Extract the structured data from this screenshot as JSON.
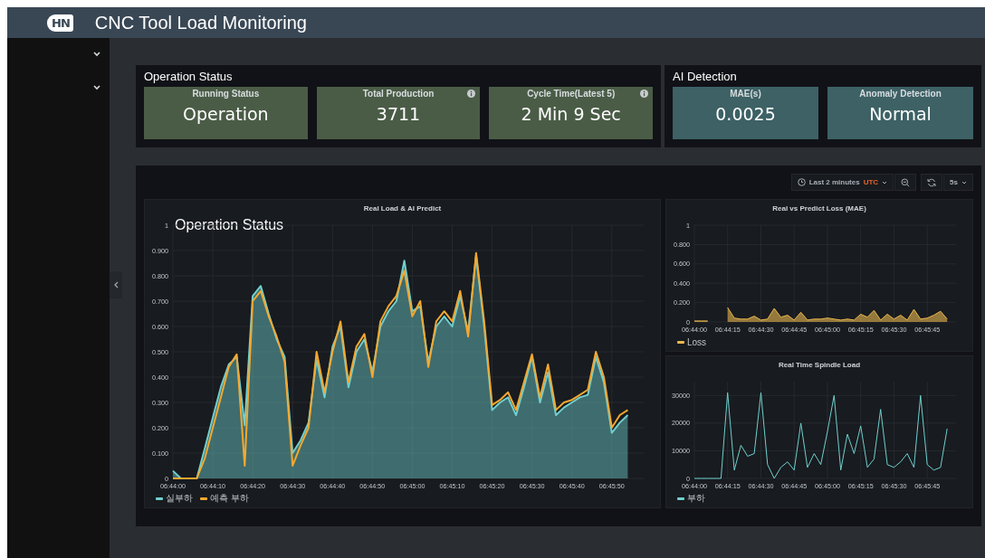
{
  "header": {
    "logo": "HN",
    "title": "CNC Tool Load Monitoring"
  },
  "status_panels": [
    {
      "title": "Operation Status",
      "cards": [
        {
          "label": "Running Status",
          "value": "Operation",
          "info": false,
          "color": "#4a5c46"
        },
        {
          "label": "Total Production",
          "value": "3711",
          "info": true,
          "color": "#4a5c46"
        },
        {
          "label": "Cycle Time(Latest 5)",
          "value": "2 Min 9 Sec",
          "info": true,
          "color": "#4a5c46"
        }
      ]
    },
    {
      "title": "AI Detection",
      "cards": [
        {
          "label": "MAE(s)",
          "value": "0.0025",
          "info": false,
          "color": "#3d6165"
        },
        {
          "label": "Anomaly Detection",
          "value": "Normal",
          "info": false,
          "color": "#3d6165"
        }
      ]
    }
  ],
  "toolbar": {
    "time_range": "Last 2 minutes",
    "timezone": "UTC",
    "refresh": "5s"
  },
  "charts": [
    {
      "overlay": "Operation Status",
      "chart_data": {
        "type": "area",
        "title": "Real Load & AI Predict",
        "grid": true,
        "categories": [
          "06:44:00",
          null,
          null,
          null,
          null,
          "06:44:10",
          null,
          null,
          null,
          null,
          "06:44:20",
          null,
          null,
          null,
          null,
          "06:44:30",
          null,
          null,
          null,
          null,
          "06:44:40",
          null,
          null,
          null,
          null,
          "06:44:50",
          null,
          null,
          null,
          null,
          "06:45:00",
          null,
          null,
          null,
          null,
          "06:45:10",
          null,
          null,
          null,
          null,
          "06:45:20",
          null,
          null,
          null,
          null,
          "06:45:30",
          null,
          null,
          null,
          null,
          "06:45:40",
          null,
          null,
          null,
          null,
          "06:45:50",
          null,
          null
        ],
        "series": [
          {
            "name": "실부하",
            "color": "#6fd0cf",
            "values": [
              0.03,
              0,
              0,
              0,
              0.12,
              0.24,
              0.36,
              0.45,
              0.48,
              0.21,
              0.72,
              0.76,
              0.65,
              0.55,
              0.48,
              0.1,
              0.15,
              0.22,
              0.47,
              0.32,
              0.52,
              0.6,
              0.36,
              0.5,
              0.55,
              0.42,
              0.6,
              0.66,
              0.7,
              0.86,
              0.66,
              0.68,
              0.46,
              0.6,
              0.64,
              0.6,
              0.72,
              0.58,
              0.88,
              0.6,
              0.27,
              0.3,
              0.32,
              0.25,
              0.36,
              0.48,
              0.3,
              0.42,
              0.25,
              0.28,
              0.3,
              0.32,
              0.33,
              0.48,
              0.38,
              0.18,
              0.22,
              0.25
            ]
          },
          {
            "name": "예측 부하",
            "type": "line",
            "color": "#f5a830",
            "values": [
              0,
              0,
              0,
              0,
              0.08,
              0.2,
              0.32,
              0.44,
              0.49,
              0.05,
              0.7,
              0.74,
              0.64,
              0.56,
              0.46,
              0.05,
              0.13,
              0.2,
              0.5,
              0.34,
              0.5,
              0.62,
              0.38,
              0.52,
              0.57,
              0.4,
              0.62,
              0.68,
              0.72,
              0.82,
              0.64,
              0.7,
              0.44,
              0.62,
              0.66,
              0.62,
              0.74,
              0.56,
              0.89,
              0.62,
              0.29,
              0.31,
              0.34,
              0.27,
              0.38,
              0.49,
              0.32,
              0.45,
              0.27,
              0.3,
              0.31,
              0.33,
              0.35,
              0.5,
              0.4,
              0.2,
              0.25,
              0.27
            ]
          }
        ],
        "ylim": [
          0,
          1
        ],
        "yticks": [
          0,
          {
            "value": 0.1,
            "label": "0.100"
          },
          {
            "value": 0.2,
            "label": "0.200"
          },
          {
            "value": 0.3,
            "label": "0.300"
          },
          {
            "value": 0.4,
            "label": "0.400"
          },
          {
            "value": 0.5,
            "label": "0.500"
          },
          {
            "value": 0.6,
            "label": "0.600"
          },
          {
            "value": 0.7,
            "label": "0.700"
          },
          {
            "value": 0.8,
            "label": "0.800"
          },
          {
            "value": 0.9,
            "label": "0.900"
          },
          1
        ]
      }
    },
    {
      "chart_data": {
        "type": "area",
        "title": "Real vs Predict Loss (MAE)",
        "grid": true,
        "categories": [
          "06:44:00",
          null,
          null,
          null,
          null,
          "06:44:15",
          null,
          null,
          null,
          null,
          "06:44:30",
          null,
          null,
          null,
          null,
          "06:44:45",
          null,
          null,
          null,
          null,
          "06:45:00",
          null,
          null,
          null,
          null,
          "06:45:15",
          null,
          null,
          null,
          null,
          "06:45:30",
          null,
          null,
          null,
          null,
          "06:45:45",
          null,
          null,
          null
        ],
        "series": [
          {
            "name": "Loss",
            "color": "#eab84f",
            "values": [
              0.01,
              0.01,
              0.01,
              null,
              null,
              0.15,
              0.04,
              0.03,
              0.03,
              0.06,
              0.02,
              0.03,
              0.14,
              0.05,
              0.07,
              0.02,
              0.1,
              0.02,
              0.03,
              0.03,
              0.04,
              0.03,
              0.02,
              0.03,
              0.02,
              0.08,
              0.05,
              0.12,
              0.02,
              0.08,
              0.03,
              0.07,
              0.02,
              0.13,
              0.03,
              0.04,
              0.07,
              0.11,
              0.03
            ]
          }
        ],
        "ylim": [
          0,
          1
        ],
        "yticks": [
          0,
          {
            "value": 0.2,
            "label": "0.200"
          },
          {
            "value": 0.4,
            "label": "0.400"
          },
          {
            "value": 0.6,
            "label": "0.600"
          },
          {
            "value": 0.8,
            "label": "0.800"
          },
          1
        ]
      }
    },
    {
      "chart_data": {
        "type": "line",
        "title": "Real Time Spindle Load",
        "grid": true,
        "categories": [
          "06:44:00",
          null,
          null,
          null,
          null,
          "06:44:15",
          null,
          null,
          null,
          null,
          "06:44:30",
          null,
          null,
          null,
          null,
          "06:44:45",
          null,
          null,
          null,
          null,
          "06:45:00",
          null,
          null,
          null,
          null,
          "06:45:15",
          null,
          null,
          null,
          null,
          "06:45:30",
          null,
          null,
          null,
          null,
          "06:45:45",
          null,
          null,
          null
        ],
        "series": [
          {
            "name": "부하",
            "color": "#6fd0cf",
            "values": [
              0,
              0,
              0,
              0,
              0,
              31000,
              3000,
              12000,
              8000,
              9000,
              31000,
              5000,
              0,
              4000,
              6000,
              3000,
              20000,
              4000,
              9000,
              5000,
              17000,
              30000,
              3000,
              16000,
              9000,
              19000,
              4000,
              7000,
              25000,
              5000,
              4000,
              6000,
              9000,
              4000,
              30000,
              5000,
              3000,
              4000,
              18000
            ]
          }
        ],
        "ylim": [
          0,
          35000
        ],
        "yticks": [
          0,
          10000,
          20000,
          30000
        ]
      }
    }
  ]
}
